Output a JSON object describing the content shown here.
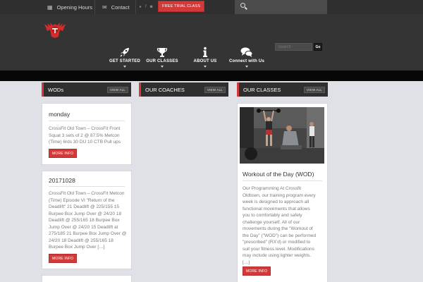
{
  "topbar": {
    "opening_hours": "Opening Hours",
    "contact": "Contact",
    "social_icons": [
      "youtube-icon",
      "facebook-icon",
      "instagram-icon"
    ],
    "free_trial": "FREE TRIAL CLASS"
  },
  "header": {
    "nav": [
      {
        "label": "GET STARTED",
        "icon": "rocket-icon"
      },
      {
        "label": "OUR CLASSES",
        "icon": "trophy-icon"
      },
      {
        "label": "ABOUT US",
        "icon": "info-icon"
      },
      {
        "label": "Connect with Us",
        "icon": "chat-icon"
      }
    ],
    "search_placeholder": "Search",
    "go_label": "Go"
  },
  "columns": {
    "wods": {
      "title": "WODs",
      "view_all": "VIEW ALL",
      "cards": [
        {
          "title": "monday",
          "text": [
            "CrossFit Old Town – CrossFit Front",
            "Squat 3 sets of 2 @ 87.5% Metcon",
            "(Time) 6rds 30 DU 10 CTB Pull ups"
          ],
          "more": "MORE INFO"
        },
        {
          "title": "20171028",
          "text": [
            "CrossFit Old Town – CrossFit Metcon",
            "(Time) Episode VI \"Return of the",
            "Deadlift\" 21 Deadlift @ 225/155 15",
            "Burpee Box Jump Over @ 24/20 18",
            "Deadlift @ 255/165 18 Burpee Box",
            "Jump Over @ 24/20 15 Deadlift at",
            "275/185 21 Burpee Box Jump Over @",
            "24/20 18 Deadlift @ 255/165 18",
            "Burpee Box Jump Over […]"
          ],
          "more": "MORE INFO"
        }
      ]
    },
    "coaches": {
      "title": "OUR COACHES",
      "view_all": "VIEW ALL"
    },
    "classes": {
      "title": "OUR CLASSES",
      "view_all": "VIEW ALL",
      "card": {
        "title": "Workout of the Day (WOD)",
        "text": [
          "Our Programming At Crossfit",
          "Oldtown, our training program every",
          "week is designed to approach all",
          "functional movements that allows",
          "you to comfortably and safely",
          "challenge yourself. All of our",
          "movements during the \"Workout of",
          "the Day\" (\"WOD\") can be performed",
          "\"prescribed\" (RX'd) or modified to",
          "suit your fitness level. Modifications",
          "may include using lighter weights.",
          "[…]"
        ],
        "more": "MORE INFO"
      }
    }
  },
  "colors": {
    "accent": "#d23a3a",
    "topbar": "#2f2f2f",
    "header": "#343434",
    "page_bg": "#dfe1e6"
  }
}
